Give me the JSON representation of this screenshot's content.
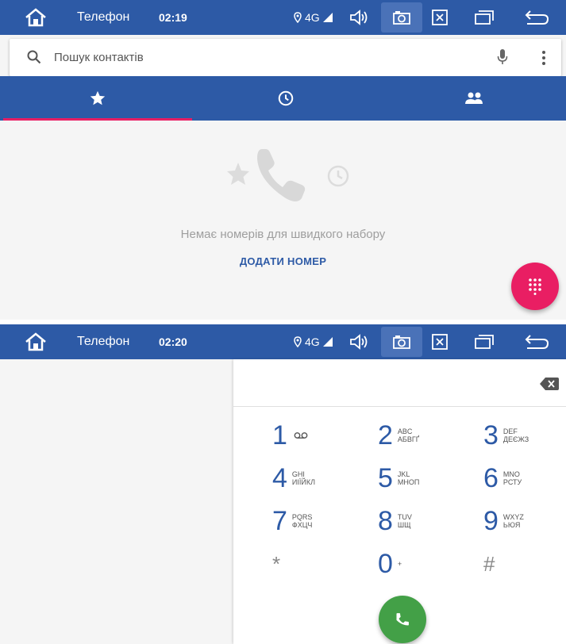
{
  "screen1": {
    "status": {
      "title": "Телефон",
      "time": "02:19",
      "network": "4G"
    },
    "search": {
      "placeholder": "Пошук контактів"
    },
    "tabs": [
      {
        "icon": "star-icon"
      },
      {
        "icon": "clock-icon"
      },
      {
        "icon": "people-icon"
      }
    ],
    "empty": {
      "message": "Немає номерів для швидкого набору",
      "action": "ДОДАТИ НОМЕР"
    },
    "fab_icon": "dialpad-icon"
  },
  "screen2": {
    "status": {
      "title": "Телефон",
      "time": "02:20",
      "network": "4G"
    },
    "keys": [
      {
        "digit": "1",
        "line1": "",
        "line2": "",
        "voicemail": true
      },
      {
        "digit": "2",
        "line1": "ABC",
        "line2": "АБВГҐ"
      },
      {
        "digit": "3",
        "line1": "DEF",
        "line2": "ДЕЄЖЗ"
      },
      {
        "digit": "4",
        "line1": "GHI",
        "line2": "ИІЇЙКЛ"
      },
      {
        "digit": "5",
        "line1": "JKL",
        "line2": "МНОП"
      },
      {
        "digit": "6",
        "line1": "MNO",
        "line2": "РСТУ"
      },
      {
        "digit": "7",
        "line1": "PQRS",
        "line2": "ФХЦЧ"
      },
      {
        "digit": "8",
        "line1": "TUV",
        "line2": "ШЩ"
      },
      {
        "digit": "9",
        "line1": "WXYZ",
        "line2": "ЬЮЯ"
      },
      {
        "digit": "*",
        "line1": "",
        "line2": ""
      },
      {
        "digit": "0",
        "line1": "+",
        "line2": ""
      },
      {
        "digit": "#",
        "line1": "",
        "line2": ""
      }
    ],
    "fab_icon": "call-icon"
  },
  "colors": {
    "primary": "#2d5aa6",
    "accent": "#e91e63",
    "call": "#43a047"
  }
}
